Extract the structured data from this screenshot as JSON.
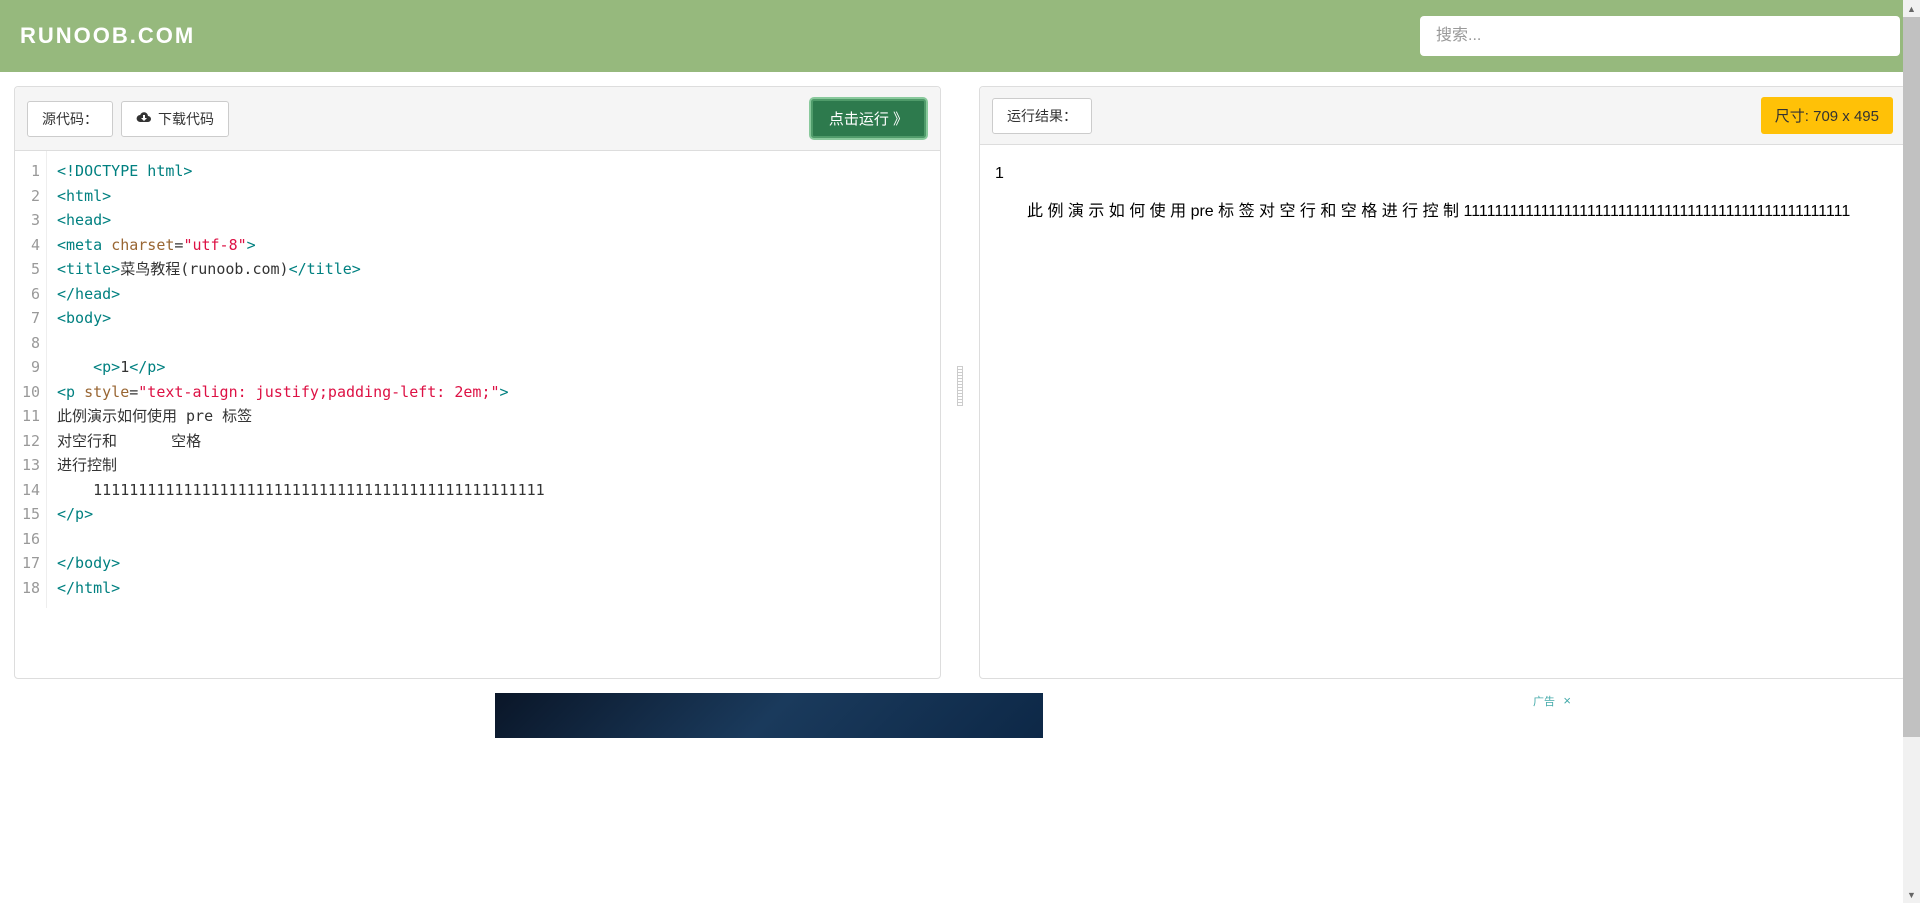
{
  "header": {
    "logo": "RUNOOB.COM",
    "search_placeholder": "搜索..."
  },
  "left_panel": {
    "source_label": "源代码：",
    "download_label": "下载代码",
    "run_label": "点击运行 》",
    "line_count": 18,
    "code": {
      "l1": {
        "tag": "<!DOCTYPE html>"
      },
      "l2": {
        "tag": "<html>"
      },
      "l3": {
        "tag": "<head>"
      },
      "l4": {
        "open": "<meta ",
        "attr": "charset",
        "eq": "=",
        "val": "\"utf-8\"",
        "close": ">"
      },
      "l5": {
        "open": "<title>",
        "text": "菜鸟教程(runoob.com)",
        "close": "</title>"
      },
      "l6": {
        "tag": "</head>"
      },
      "l7": {
        "tag": "<body>"
      },
      "l8": {
        "text": ""
      },
      "l9": {
        "indent": "    ",
        "open": "<p>",
        "text": "1",
        "close": "</p>"
      },
      "l10": {
        "open": "<p ",
        "attr": "style",
        "eq": "=",
        "val": "\"text-align: justify;padding-left: 2em;\"",
        "close": ">"
      },
      "l11": {
        "text": "此例演示如何使用 pre 标签"
      },
      "l12": {
        "text": "对空行和      空格"
      },
      "l13": {
        "text": "进行控制"
      },
      "l14": {
        "text": "    11111111111111111111111111111111111111111111111111"
      },
      "l15": {
        "tag": "</p>"
      },
      "l16": {
        "text": ""
      },
      "l17": {
        "tag": "</body>"
      },
      "l18": {
        "tag": "</html>"
      }
    }
  },
  "right_panel": {
    "result_label": "运行结果：",
    "size_label": "尺寸: 709 x 495",
    "output": {
      "p1": "1",
      "p2": "此 例 演 示 如 何 使 用   pre  标 签   对 空 行 和    空 格   进 行 控 制 11111111111111111111111111111111111111111111111111"
    }
  },
  "ad": {
    "label": "广告",
    "close": "×"
  }
}
